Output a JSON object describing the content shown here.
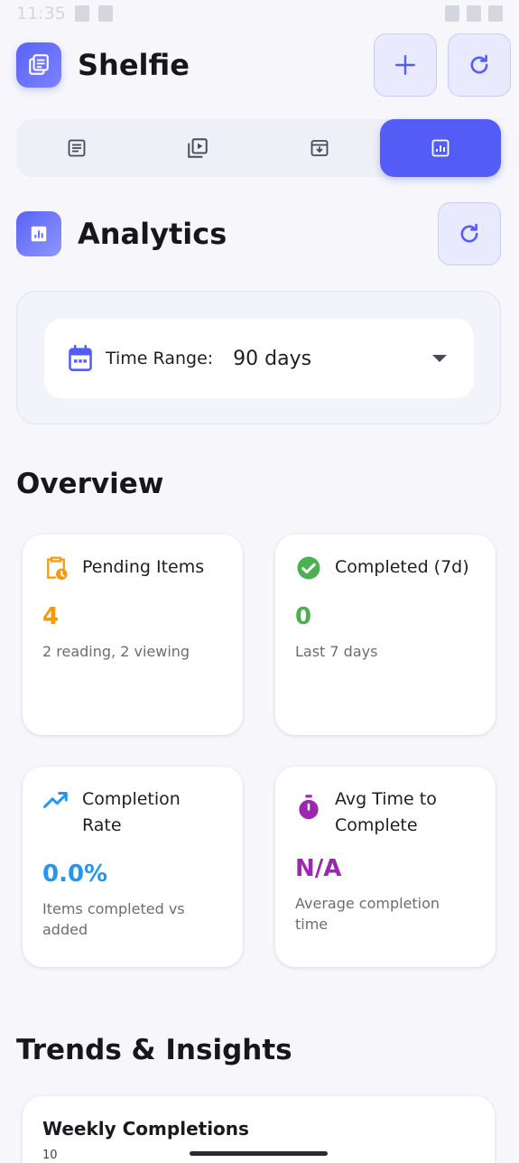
{
  "status_bar": {
    "time": "11:35"
  },
  "app": {
    "title": "Shelfie"
  },
  "header": {
    "add_icon": "plus-icon",
    "refresh_icon": "refresh-icon"
  },
  "tabs": [
    {
      "icon": "article-icon",
      "active": false
    },
    {
      "icon": "video-library-icon",
      "active": false
    },
    {
      "icon": "archive-icon",
      "active": false
    },
    {
      "icon": "analytics-icon",
      "active": true
    }
  ],
  "section": {
    "title": "Analytics"
  },
  "time_range": {
    "label": "Time Range:",
    "value": "90 days"
  },
  "overview": {
    "title": "Overview",
    "cards": [
      {
        "title": "Pending Items",
        "value": "4",
        "subtitle": "2 reading, 2 viewing",
        "color": "#f29b0f",
        "icon": "pending-clipboard-icon"
      },
      {
        "title": "Completed (7d)",
        "value": "0",
        "subtitle": "Last 7 days",
        "color": "#4caf50",
        "icon": "check-circle-icon"
      },
      {
        "title": "Completion Rate",
        "value": "0.0%",
        "subtitle": "Items completed vs added",
        "color": "#2196f3",
        "icon": "trending-up-icon"
      },
      {
        "title": "Avg Time to Complete",
        "value": "N/A",
        "subtitle": "Average completion time",
        "color": "#9c27b0",
        "icon": "timer-icon"
      }
    ]
  },
  "trends": {
    "title": "Trends & Insights",
    "weekly": {
      "title": "Weekly Completions",
      "tick": "10"
    }
  },
  "colors": {
    "accent": "#535cf5",
    "accent_light": "#e9eafd"
  }
}
